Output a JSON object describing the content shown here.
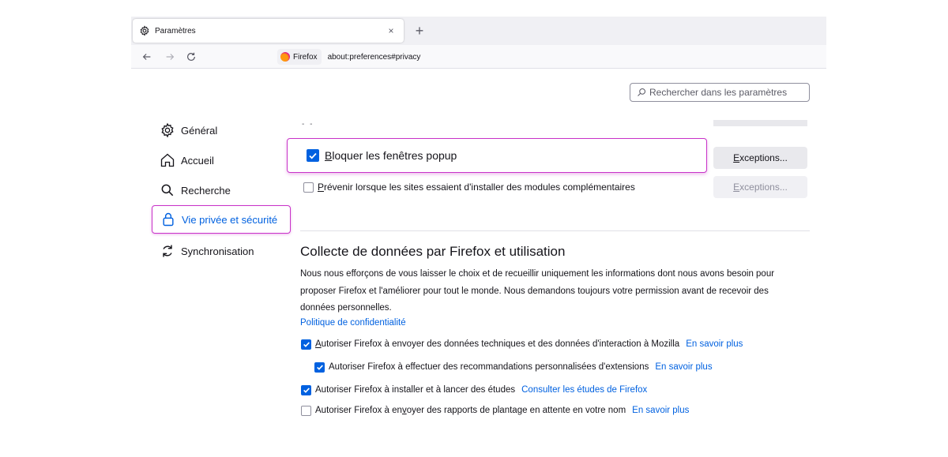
{
  "tab": {
    "title": "Paramètres",
    "close_glyph": "×",
    "icon": "gear-icon"
  },
  "newtab": {
    "glyph": "+"
  },
  "nav": {
    "identity_label": "Firefox",
    "url": "about:preferences#privacy"
  },
  "search": {
    "placeholder": "Rechercher dans les paramètres"
  },
  "sidebar": {
    "items": [
      {
        "label": "Général",
        "icon": "gear-icon"
      },
      {
        "label": "Accueil",
        "icon": "home-icon"
      },
      {
        "label": "Recherche",
        "icon": "search-icon"
      },
      {
        "label": "Vie privée et sécurité",
        "icon": "lock-icon",
        "selected": true
      },
      {
        "label": "Synchronisation",
        "icon": "sync-icon"
      }
    ]
  },
  "permissions": {
    "cut_dash": "- -",
    "popup": {
      "label_first": "B",
      "label_rest": "loquer les fenêtres popup",
      "checked": true
    },
    "popup_exceptions": {
      "label_first": "E",
      "label_rest": "xceptions..."
    },
    "addons": {
      "label_first": "P",
      "label_rest": "révenir lorsque les sites essaient d'installer des modules complémentaires",
      "checked": false
    },
    "addons_exceptions": {
      "label_first": "E",
      "label_rest": "xceptions..."
    }
  },
  "data_collection": {
    "title": "Collecte de données par Firefox et utilisation",
    "description": "Nous nous efforçons de vous laisser le choix et de recueillir uniquement les informations dont nous avons besoin pour proposer Firefox et l'améliorer pour tout le monde. Nous demandons toujours votre permission avant de recevoir des données personnelles.",
    "privacy_link": "Politique de confidentialité",
    "options": [
      {
        "label_first": "A",
        "label_rest": "utoriser Firefox à envoyer des données techniques et des données d'interaction à Mozilla",
        "link": "En savoir plus",
        "checked": true
      },
      {
        "label": "Autoriser Firefox à effectuer des recommandations personnalisées d'extensions",
        "link": "En savoir plus",
        "checked": true
      },
      {
        "label": "Autoriser Firefox à installer et à lancer des études",
        "link": "Consulter les études de Firefox",
        "checked": true
      },
      {
        "label_a": "Autoriser Firefox à en",
        "label_u": "v",
        "label_b": "oyer des rapports de plantage en attente en votre nom",
        "link": "En savoir plus",
        "checked": false
      }
    ]
  },
  "colors": {
    "accent": "#0061e0",
    "highlight": "#c832c8"
  }
}
